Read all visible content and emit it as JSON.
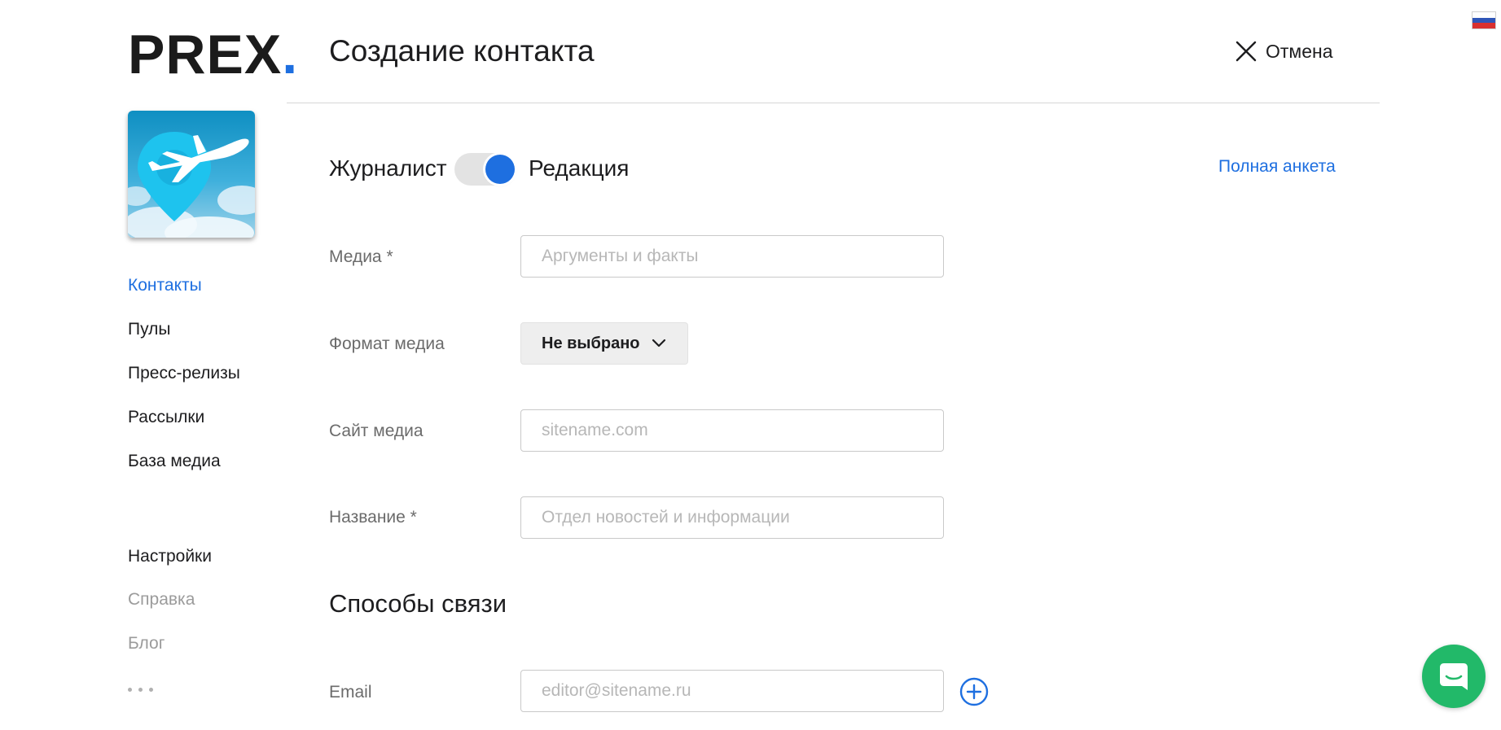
{
  "brand": {
    "name": "PREX",
    "dot": ".",
    "accent_color": "#1e6fe0"
  },
  "sidebar": {
    "avatar_icon": "airplane-location-pin",
    "items": [
      {
        "label": "Контакты",
        "state": "active"
      },
      {
        "label": "Пулы"
      },
      {
        "label": "Пресс-релизы"
      },
      {
        "label": "Рассылки"
      },
      {
        "label": "База медиа"
      }
    ],
    "secondary": [
      {
        "label": "Настройки"
      },
      {
        "label": "Справка",
        "state": "muted"
      },
      {
        "label": "Блог",
        "state": "muted"
      }
    ],
    "more_icon": "ellipsis-icon"
  },
  "header": {
    "title": "Создание контакта",
    "cancel_label": "Отмена",
    "cancel_icon": "close-icon"
  },
  "type_toggle": {
    "left_label": "Журналист",
    "right_label": "Редакция",
    "selected": "Редакция"
  },
  "full_form_link": "Полная анкета",
  "form": {
    "media": {
      "label": "Медиа *",
      "placeholder": "Аргументы и факты"
    },
    "media_format": {
      "label": "Формат медиа",
      "value": "Не выбрано"
    },
    "media_site": {
      "label": "Сайт медиа",
      "placeholder": "sitename.com"
    },
    "name": {
      "label": "Название *",
      "placeholder": "Отдел новостей и информации"
    }
  },
  "contacts_section": {
    "title": "Способы связи",
    "email": {
      "label": "Email",
      "placeholder": "editor@sitename.ru"
    },
    "add_icon": "plus-circle-icon"
  },
  "language_flag": "ru-flag-icon",
  "chat_icon": "chat-bubble-icon",
  "colors": {
    "chat": "#22b969",
    "link": "#1e6fe0"
  }
}
